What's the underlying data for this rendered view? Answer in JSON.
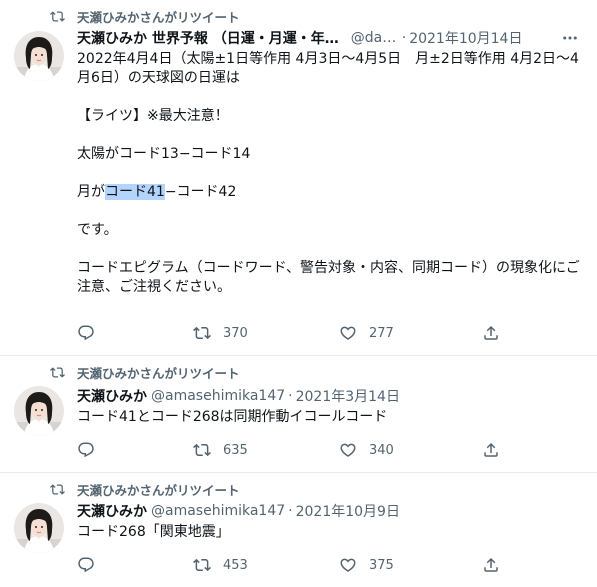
{
  "tweets": [
    {
      "retweet_label": "天瀬ひみかさんがリツイート",
      "name": "天瀬ひみか 世界予報 （日運・月運・年…",
      "handle": "@dail…",
      "dot": "·",
      "date": "2021年10月14日",
      "body": [
        "2022年4月4日（太陽±1日等作用 4月3日〜4月5日　月±2日等作用 4月2日〜4月6日）の天球図の日運は",
        "【ライツ】※最大注意！",
        "太陽がコード13−コード14",
        "月がコード41−コード42",
        "です。",
        "コードエピグラム（コードワード、警告対象・内容、同期コード）の現象化にご注意、ご注視ください。"
      ],
      "line4_parts": [
        "月が",
        "コード41",
        "−コード42"
      ],
      "reply_count": "",
      "retweet_count": "370",
      "like_count": "277"
    },
    {
      "retweet_label": "天瀬ひみかさんがリツイート",
      "name": "天瀬ひみか",
      "handle": "@amasehimika147",
      "dot": "·",
      "date": "2021年3月14日",
      "body": [
        "コード41とコード268は同期作動イコールコード"
      ],
      "retweet_count": "635",
      "like_count": "340"
    },
    {
      "retweet_label": "天瀬ひみかさんがリツイート",
      "name": "天瀬ひみか",
      "handle": "@amasehimika147",
      "dot": "·",
      "date": "2021年10月9日",
      "body": [
        "コード268「関東地震」"
      ],
      "retweet_count": "453",
      "like_count": "375"
    }
  ],
  "icons": {
    "retweet_indicator": "retweet-icon",
    "reply": "reply-icon",
    "retweet": "retweet-icon",
    "like": "heart-icon",
    "share": "share-icon",
    "more": "more-icon"
  },
  "colors": {
    "text": "#0f1419",
    "secondary": "#536471",
    "divider": "#e6ecf0",
    "highlight": "#b3d4fc"
  }
}
